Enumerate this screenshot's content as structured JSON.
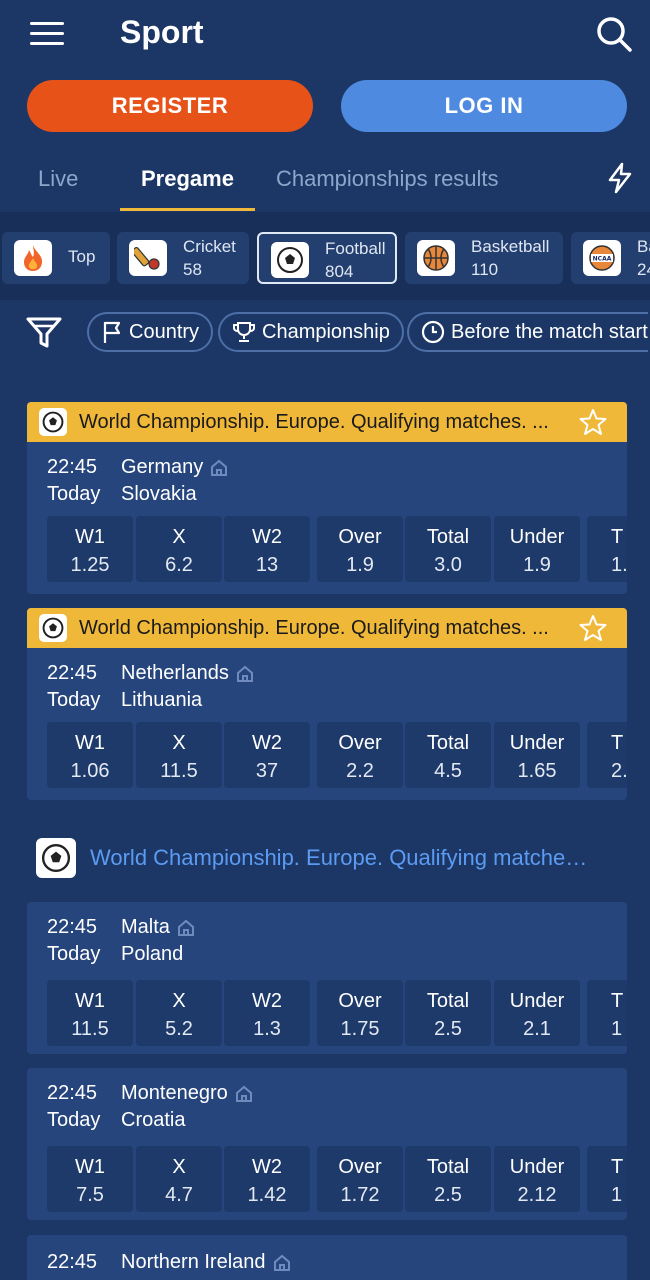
{
  "header": {
    "title": "Sport"
  },
  "auth": {
    "register": "REGISTER",
    "login": "LOG IN"
  },
  "tabs": [
    {
      "label": "Live"
    },
    {
      "label": "Pregame"
    },
    {
      "label": "Championships results"
    }
  ],
  "sports": [
    {
      "name": "Top",
      "count": ""
    },
    {
      "name": "Cricket",
      "count": "58"
    },
    {
      "name": "Football",
      "count": "804"
    },
    {
      "name": "Basketball",
      "count": "110"
    },
    {
      "name": "Ba",
      "count": "24"
    }
  ],
  "filters": {
    "country": "Country",
    "championship": "Championship",
    "before_start": "Before the match start"
  },
  "matches": [
    {
      "league": "World Championship. Europe. Qualifying matches. ...",
      "time": "22:45",
      "day": "Today",
      "team1": "Germany",
      "team2": "Slovakia",
      "odds": [
        {
          "label": "W1",
          "value": "1.25"
        },
        {
          "label": "X",
          "value": "6.2"
        },
        {
          "label": "W2",
          "value": "13"
        },
        {
          "label": "Over",
          "value": "1.9"
        },
        {
          "label": "Total",
          "value": "3.0"
        },
        {
          "label": "Under",
          "value": "1.9"
        },
        {
          "label": "T",
          "value": "1."
        }
      ]
    },
    {
      "league": "World Championship. Europe. Qualifying matches. ...",
      "time": "22:45",
      "day": "Today",
      "team1": "Netherlands",
      "team2": "Lithuania",
      "odds": [
        {
          "label": "W1",
          "value": "1.06"
        },
        {
          "label": "X",
          "value": "11.5"
        },
        {
          "label": "W2",
          "value": "37"
        },
        {
          "label": "Over",
          "value": "2.2"
        },
        {
          "label": "Total",
          "value": "4.5"
        },
        {
          "label": "Under",
          "value": "1.65"
        },
        {
          "label": "T",
          "value": "2."
        }
      ]
    }
  ],
  "championship": {
    "title": "World Championship. Europe. Qualifying matche…",
    "matches": [
      {
        "time": "22:45",
        "day": "Today",
        "team1": "Malta",
        "team2": "Poland",
        "odds": [
          {
            "label": "W1",
            "value": "11.5"
          },
          {
            "label": "X",
            "value": "5.2"
          },
          {
            "label": "W2",
            "value": "1.3"
          },
          {
            "label": "Over",
            "value": "1.75"
          },
          {
            "label": "Total",
            "value": "2.5"
          },
          {
            "label": "Under",
            "value": "2.1"
          },
          {
            "label": "T",
            "value": "1"
          }
        ]
      },
      {
        "time": "22:45",
        "day": "Today",
        "team1": "Montenegro",
        "team2": "Croatia",
        "odds": [
          {
            "label": "W1",
            "value": "7.5"
          },
          {
            "label": "X",
            "value": "4.7"
          },
          {
            "label": "W2",
            "value": "1.42"
          },
          {
            "label": "Over",
            "value": "1.72"
          },
          {
            "label": "Total",
            "value": "2.5"
          },
          {
            "label": "Under",
            "value": "2.12"
          },
          {
            "label": "T",
            "value": "1"
          }
        ]
      },
      {
        "time": "22:45",
        "team1": "Northern Ireland"
      }
    ]
  },
  "colors": {
    "background": "#1c3766",
    "card": "#25457c",
    "accent_yellow": "#f0b838",
    "register": "#e65218",
    "login": "#4d8ae0",
    "link": "#5c9bf2"
  }
}
